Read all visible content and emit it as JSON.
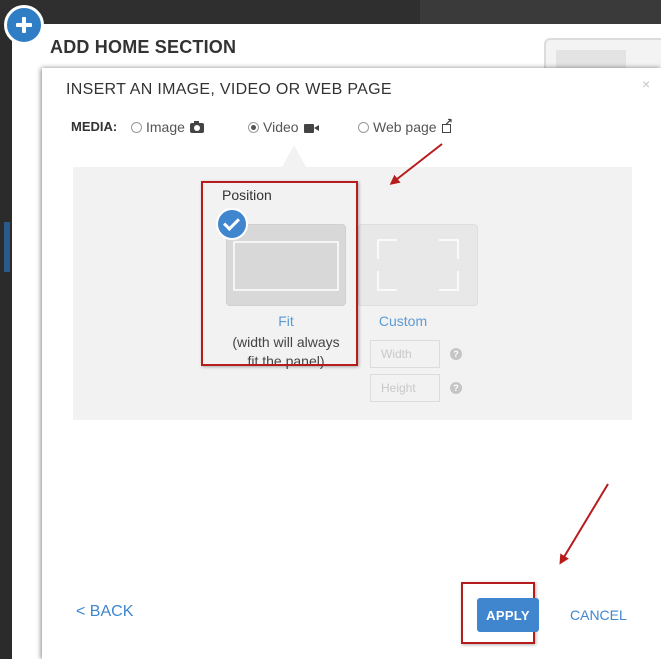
{
  "header": {
    "section_title": "ADD HOME SECTION",
    "add_icon": "plus-icon"
  },
  "dialog": {
    "title": "INSERT AN IMAGE, VIDEO OR WEB PAGE",
    "close_label": "×",
    "media": {
      "label": "MEDIA:",
      "selected": "Video",
      "options": [
        {
          "label": "Image",
          "icon": "camera-icon",
          "checked": false
        },
        {
          "label": "Video",
          "icon": "video-camera-icon",
          "checked": true
        },
        {
          "label": "Web page",
          "icon": "external-link-icon",
          "checked": false
        }
      ]
    },
    "position": {
      "label": "Position",
      "fit": {
        "label": "Fit",
        "description_line1": "(width will always",
        "description_line2": "fit the panel)",
        "selected": true
      },
      "custom": {
        "label": "Custom",
        "width_placeholder": "Width",
        "height_placeholder": "Height",
        "help_icon": "?"
      }
    },
    "footer": {
      "back_label": "< BACK",
      "apply_label": "APPLY",
      "cancel_label": "CANCEL"
    }
  },
  "colors": {
    "accent": "#3f86cf",
    "link": "#5b9bd5",
    "annotation": "#b71c1c",
    "panel_bg": "#f2f2f2"
  }
}
